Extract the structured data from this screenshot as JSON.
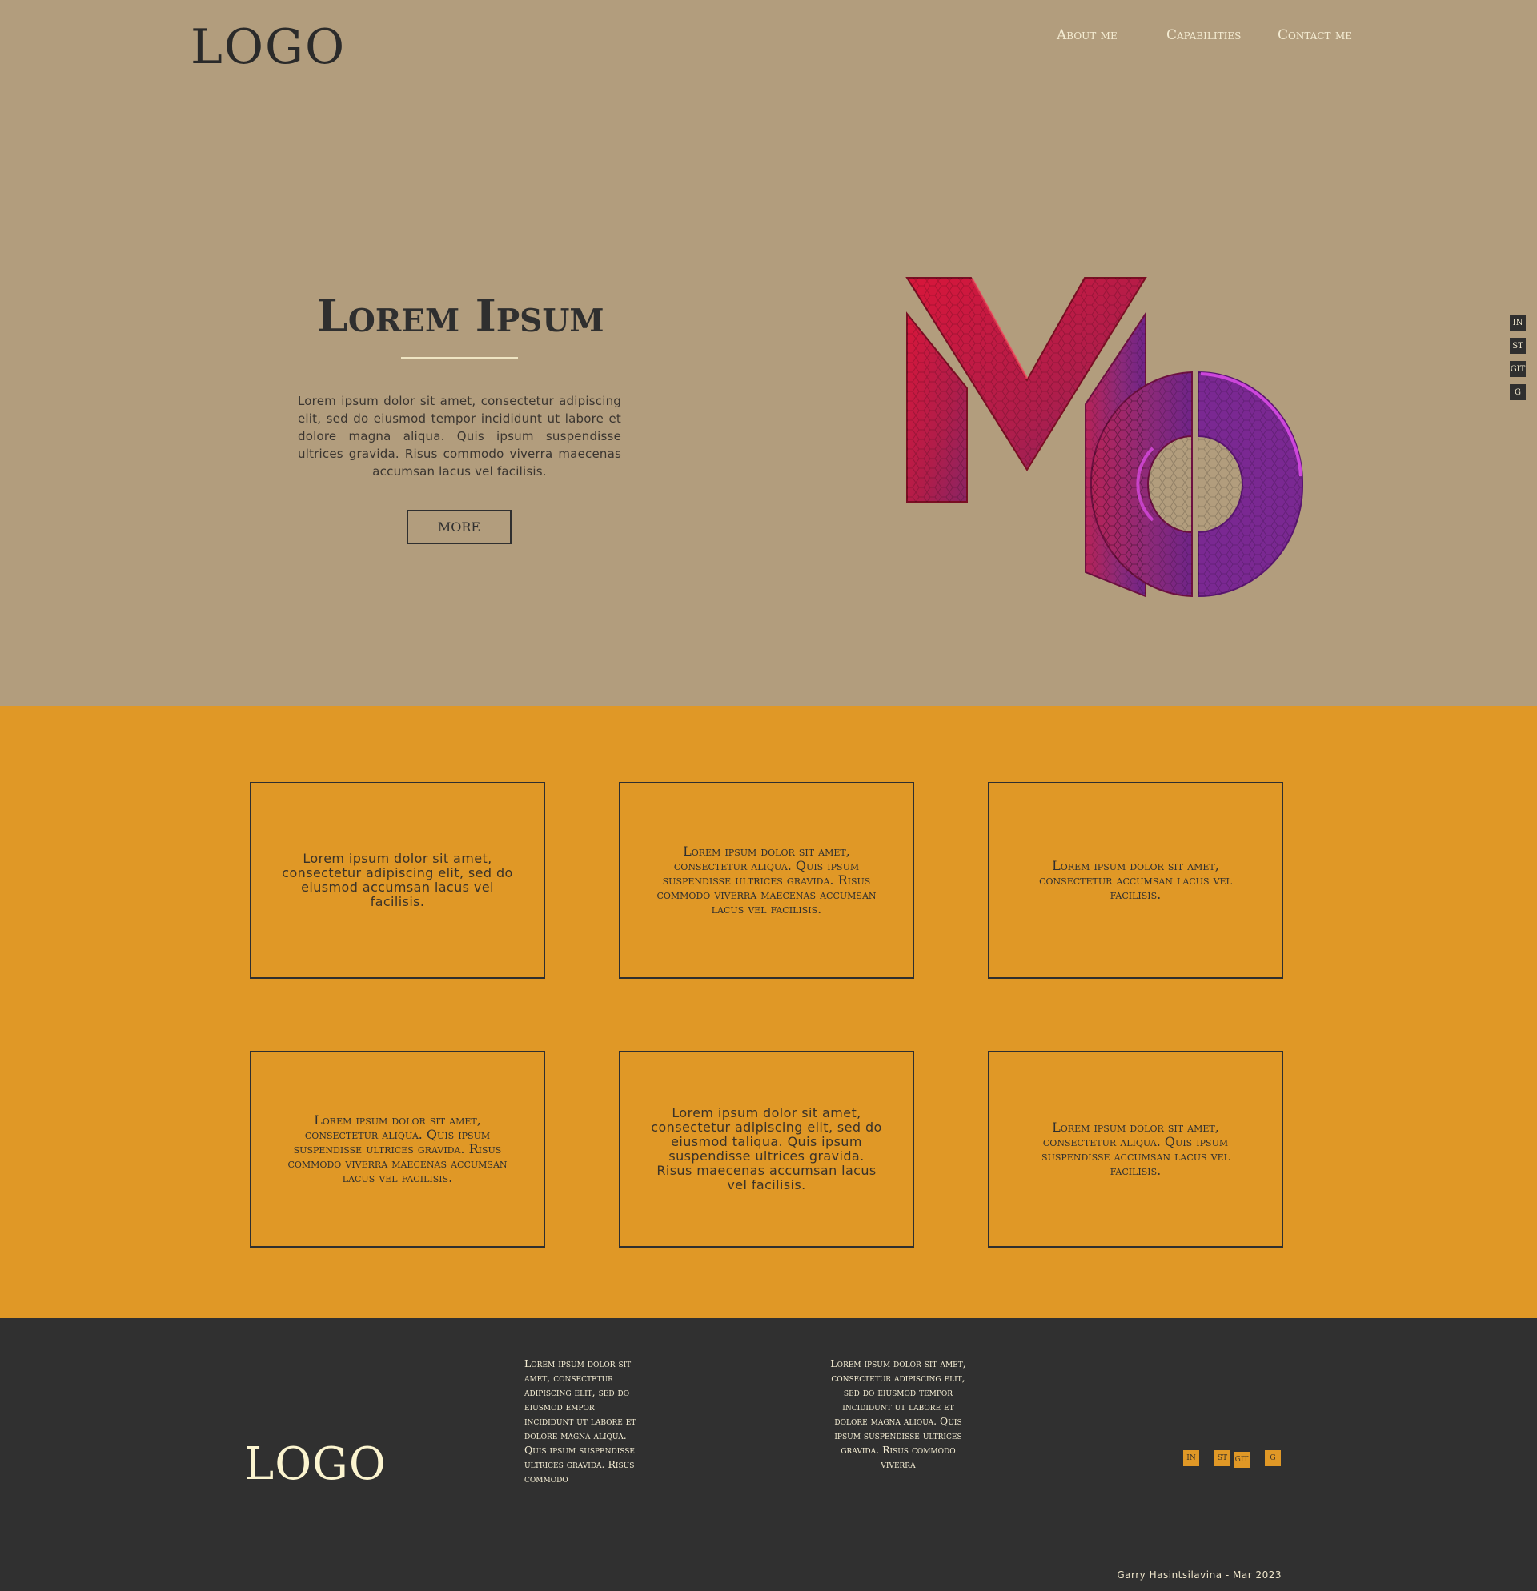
{
  "header": {
    "logo": "LOGO",
    "nav": [
      "About me",
      "Capabilities",
      "Contact me"
    ]
  },
  "hero": {
    "title": "Lorem Ipsum",
    "text": "Lorem ipsum dolor sit amet, consectetur adipiscing elit, sed do eiusmod tempor incididunt ut labore et dolore magna aliqua. Quis ipsum suspendisse ultrices gravida. Risus commodo viverra maecenas accumsan lacus vel facilisis.",
    "button": "MORE"
  },
  "side_icons": [
    "IN",
    "ST",
    "GIT",
    "G"
  ],
  "cards": [
    "Lorem ipsum dolor sit amet, consectetur adipiscing elit, sed do eiusmod accumsan lacus vel facilisis.",
    "Lorem ipsum dolor sit amet, consectetur aliqua. Quis ipsum suspendisse ultrices gravida. Risus commodo viverra maecenas accumsan lacus vel facilisis.",
    "Lorem ipsum dolor sit amet, consectetur accumsan lacus vel facilisis.",
    "Lorem ipsum dolor sit amet, consectetur aliqua. Quis ipsum suspendisse ultrices gravida. Risus commodo viverra maecenas accumsan lacus vel facilisis.",
    "Lorem ipsum dolor sit amet, consectetur adipiscing elit, sed do eiusmod taliqua. Quis ipsum suspendisse ultrices gravida. Risus maecenas accumsan lacus vel facilisis.",
    "Lorem ipsum dolor sit amet, consectetur aliqua. Quis ipsum suspendisse accumsan lacus vel facilisis."
  ],
  "footer": {
    "logo": "LOGO",
    "col1": "Lorem ipsum dolor sit amet, consectetur adipiscing elit, sed do eiusmod empor incididunt ut labore et dolore magna aliqua. Quis ipsum suspendisse ultrices gravida. Risus commodo",
    "col2": "Lorem ipsum dolor sit amet, consectetur adipiscing elit, sed do eiusmod tempor incididunt ut labore et dolore magna aliqua. Quis ipsum suspendisse ultrices gravida. Risus commodo viverra",
    "icons": [
      "IN",
      "ST",
      "GIT",
      "G"
    ],
    "credit": "Garry Hasintsilavina - Mar 2023"
  },
  "colors": {
    "hero_bg": "#b29d7d",
    "cards_bg": "#e09826",
    "footer_bg": "#303030",
    "cream": "#f4ecd2",
    "dark": "#2f2f2f"
  }
}
